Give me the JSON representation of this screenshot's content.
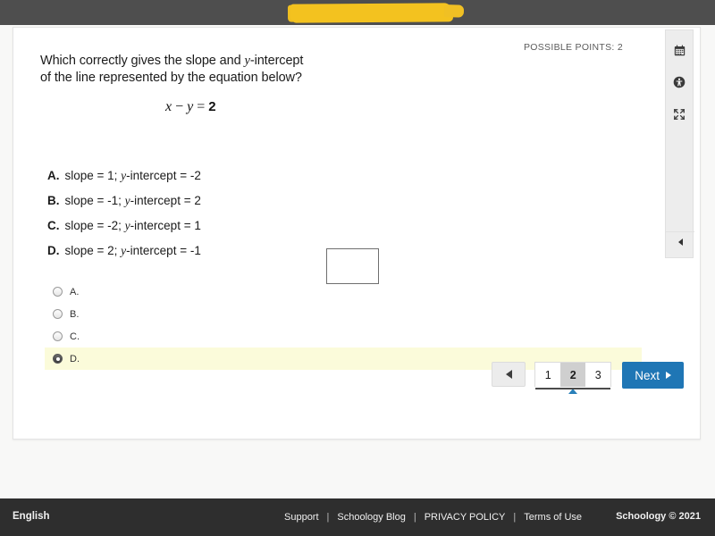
{
  "browser": {
    "redaction_note": "yellow-highlight-redaction"
  },
  "assessment": {
    "possible_points_label": "POSSIBLE POINTS: 2",
    "question": {
      "line1_before_var": "Which correctly gives the slope and ",
      "line1_var": "y",
      "line1_after_var": "-intercept",
      "line2": "of the line represented by the equation below?",
      "equation": {
        "lhs_x": "x",
        "operator": "−",
        "lhs_y": "y",
        "equals": "=",
        "rhs": "2"
      }
    },
    "choices": [
      {
        "letter": "A.",
        "before_var": "slope = 1;  ",
        "var": "y",
        "after_var": "-intercept = -2"
      },
      {
        "letter": "B.",
        "before_var": "slope = -1;  ",
        "var": "y",
        "after_var": "-intercept = 2"
      },
      {
        "letter": "C.",
        "before_var": "slope = -2;  ",
        "var": "y",
        "after_var": "-intercept = 1"
      },
      {
        "letter": "D.",
        "before_var": "slope = 2;  ",
        "var": "y",
        "after_var": "-intercept = -1"
      }
    ],
    "answers": [
      {
        "label": "A.",
        "selected": false
      },
      {
        "label": "B.",
        "selected": false
      },
      {
        "label": "C.",
        "selected": false
      },
      {
        "label": "D.",
        "selected": true
      }
    ]
  },
  "pagination": {
    "prev_icon": "triangle-left-icon",
    "pages": [
      "1",
      "2",
      "3"
    ],
    "active_page": "2",
    "next_label": "Next",
    "next_icon": "triangle-right-icon"
  },
  "toolrail": {
    "icons": [
      "calendar-icon",
      "accessibility-icon",
      "fullscreen-icon"
    ],
    "collapse_icon": "chevron-left-icon"
  },
  "footer": {
    "language": "English",
    "links": [
      "Support",
      "Schoology Blog",
      "PRIVACY POLICY",
      "Terms of Use"
    ],
    "separator": "|",
    "copyright": "Schoology © 2021"
  },
  "colors": {
    "topbar": "#4e4e4e",
    "redaction": "#f3c21f",
    "accent_blue": "#1f76b5",
    "selected_row": "#fbfbda",
    "footer": "#2e2e2e"
  }
}
